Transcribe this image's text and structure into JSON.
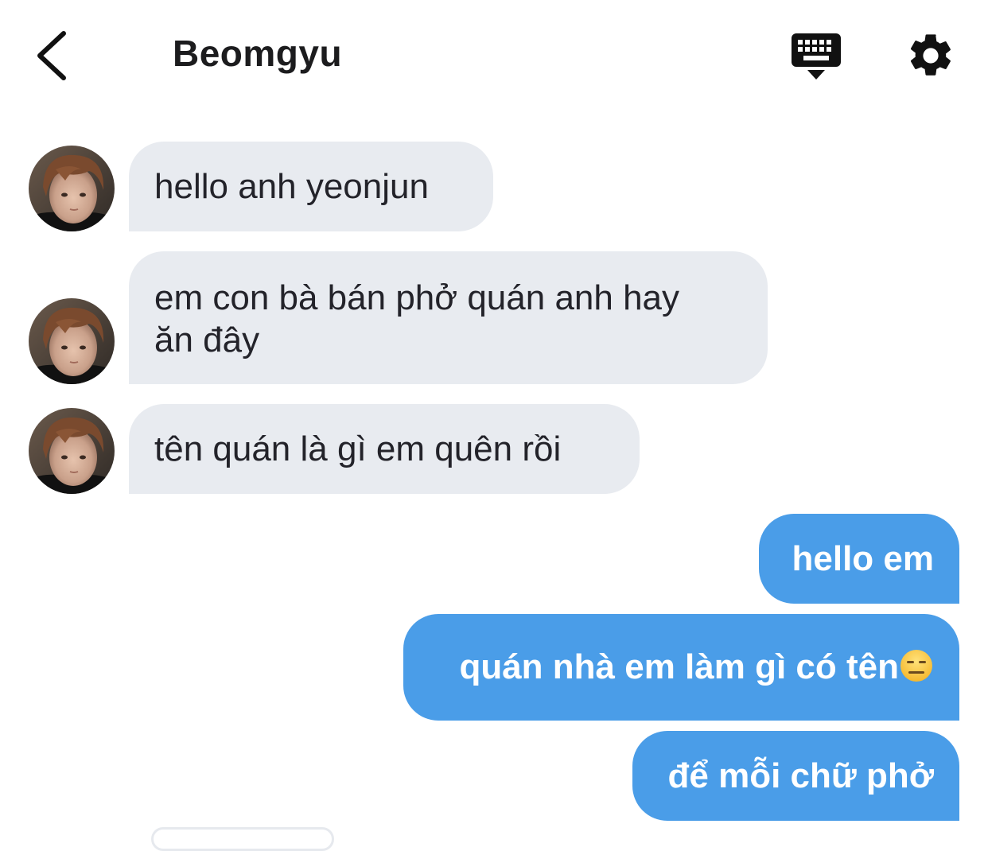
{
  "header": {
    "back_icon": "chevron-left-icon",
    "title": "Beomgyu",
    "keyboard_icon": "keyboard-icon",
    "settings_icon": "gear-icon"
  },
  "messages": [
    {
      "direction": "incoming",
      "text": "hello anh yeonjun"
    },
    {
      "direction": "incoming",
      "line1": "em con bà bán phở quán anh hay",
      "line2": "ăn đây"
    },
    {
      "direction": "incoming",
      "text": "tên quán là gì em quên rồi"
    },
    {
      "direction": "outgoing",
      "text": "hello em"
    },
    {
      "direction": "outgoing",
      "text": "quán nhà em làm gì có tên",
      "emoji": "expressionless-face-emoji"
    },
    {
      "direction": "outgoing",
      "text": "để mỗi chữ phở"
    }
  ],
  "colors": {
    "incoming_bubble": "#e8ebf0",
    "outgoing_bubble": "#4a9de8",
    "incoming_text": "#23232a",
    "outgoing_text": "#ffffff"
  }
}
